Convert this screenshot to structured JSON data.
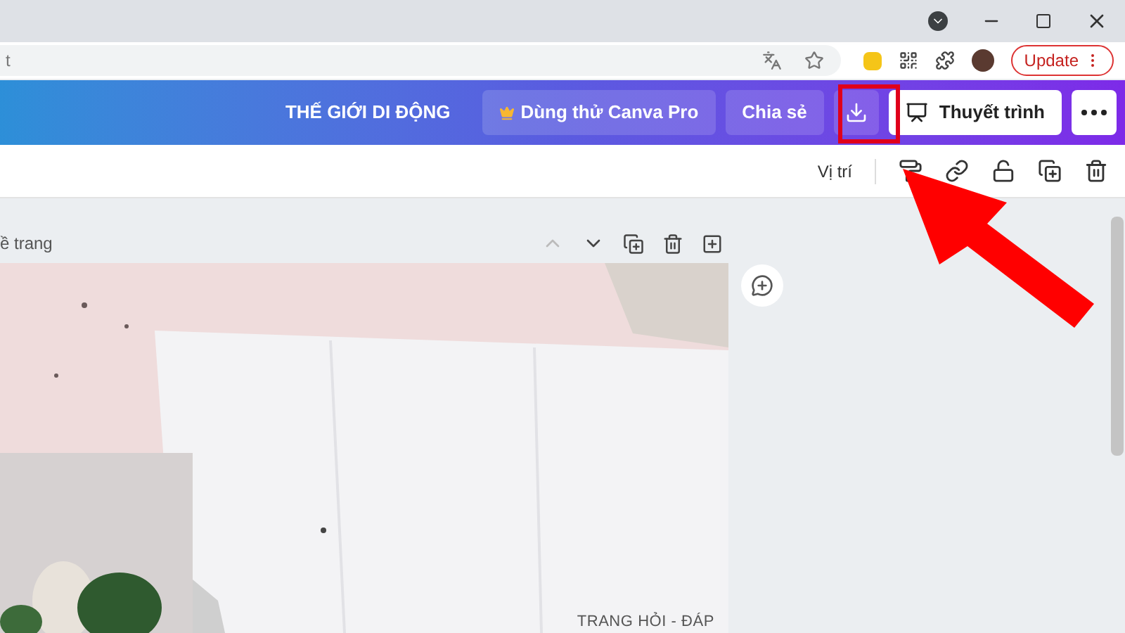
{
  "browser": {
    "address": "t",
    "update_button": "Update"
  },
  "header": {
    "team": "THẾ GIỚI DI ĐỘNG",
    "pro_button": "Dùng thử Canva Pro",
    "share_button": "Chia sẻ",
    "present_button": "Thuyết trình"
  },
  "toolbar": {
    "position_button": "Vị trí"
  },
  "page": {
    "title": "ề trang",
    "design_text": "TRANG HỎI - ĐÁP"
  }
}
